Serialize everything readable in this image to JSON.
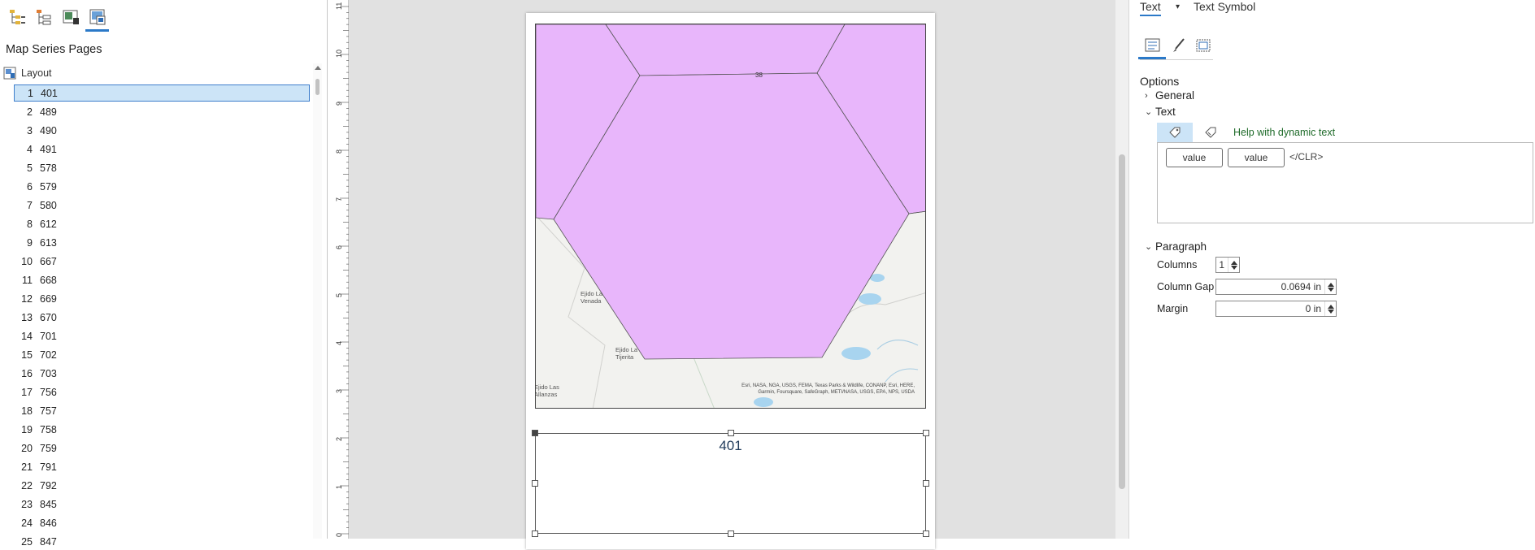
{
  "left_pane": {
    "title": "Map Series Pages",
    "toolbar": [
      "contents-list-icon",
      "drawing-order-icon",
      "layout-thumbnail-icon",
      "map-series-pages-icon"
    ],
    "layout_label": "Layout",
    "pages": [
      {
        "n": "1",
        "name": "401"
      },
      {
        "n": "2",
        "name": "489"
      },
      {
        "n": "3",
        "name": "490"
      },
      {
        "n": "4",
        "name": "491"
      },
      {
        "n": "5",
        "name": "578"
      },
      {
        "n": "6",
        "name": "579"
      },
      {
        "n": "7",
        "name": "580"
      },
      {
        "n": "8",
        "name": "612"
      },
      {
        "n": "9",
        "name": "613"
      },
      {
        "n": "10",
        "name": "667"
      },
      {
        "n": "11",
        "name": "668"
      },
      {
        "n": "12",
        "name": "669"
      },
      {
        "n": "13",
        "name": "670"
      },
      {
        "n": "14",
        "name": "701"
      },
      {
        "n": "15",
        "name": "702"
      },
      {
        "n": "16",
        "name": "703"
      },
      {
        "n": "17",
        "name": "756"
      },
      {
        "n": "18",
        "name": "757"
      },
      {
        "n": "19",
        "name": "758"
      },
      {
        "n": "20",
        "name": "759"
      },
      {
        "n": "21",
        "name": "791"
      },
      {
        "n": "22",
        "name": "792"
      },
      {
        "n": "23",
        "name": "845"
      },
      {
        "n": "24",
        "name": "846"
      },
      {
        "n": "25",
        "name": "847"
      }
    ],
    "selected_index": 0
  },
  "ruler": {
    "labels": [
      "11",
      "10",
      "9",
      "8",
      "7",
      "6",
      "5",
      "4",
      "3",
      "2",
      "1",
      "0"
    ]
  },
  "map": {
    "grid_label": "38",
    "places": [
      "Ejido La\nVenada",
      "Ejido La\nTijerita",
      "Ejido Las\nAllanzas"
    ],
    "attribution_line1": "Esri, NASA, NGA, USGS, FEMA, Texas Parks & Wildlife, CONANP, Esri, HERE,",
    "attribution_line2": "Garmin, Foursquare, SafeGraph, METI/NASA, USGS, EPA, NPS, USDA",
    "polygon_color": "#e8b6fb"
  },
  "text_element": {
    "value": "401"
  },
  "right_pane": {
    "tab_text": "Text",
    "tab_symbol": "Text Symbol",
    "options_label": "Options",
    "general_label": "General",
    "text_section_label": "Text",
    "help_dynamic": "Help with dynamic text",
    "chip1": "value",
    "chip2": "value",
    "clr_tag": "</CLR>",
    "paragraph_label": "Paragraph",
    "columns_label": "Columns",
    "columns_value": "1",
    "column_gap_label": "Column Gap",
    "column_gap_value": "0.0694 in",
    "margin_label": "Margin",
    "margin_value": "0 in"
  }
}
